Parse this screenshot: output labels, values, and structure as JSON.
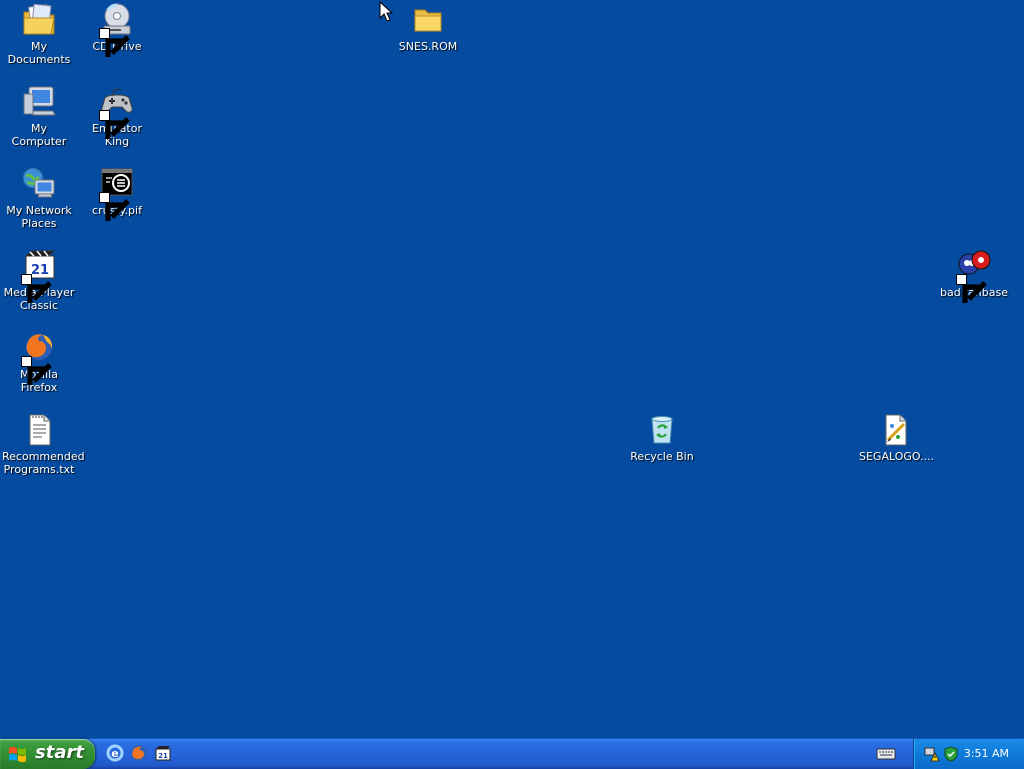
{
  "desktop": {
    "icons": [
      {
        "label": "My Documents",
        "icon": "my-documents-icon"
      },
      {
        "label": "CD Drive",
        "icon": "cd-drive-icon"
      },
      {
        "label": "SNES.ROM",
        "icon": "folder-icon"
      },
      {
        "label": "My Computer",
        "icon": "my-computer-icon"
      },
      {
        "label": "Emulator King",
        "icon": "gamepad-icon"
      },
      {
        "label": "My Network Places",
        "icon": "network-icon"
      },
      {
        "label": "crusty.pif",
        "icon": "msdos-program-icon"
      },
      {
        "label": "Media Player Classic",
        "icon": "media-player-icon"
      },
      {
        "label": "bad fanbase",
        "icon": "sonic-icon"
      },
      {
        "label": "Mozilla Firefox",
        "icon": "firefox-icon"
      },
      {
        "label": "Recommended Programs.txt",
        "icon": "text-file-icon"
      },
      {
        "label": "Recycle Bin",
        "icon": "recycle-bin-icon"
      },
      {
        "label": "SEGALOGO....",
        "icon": "paint-image-icon"
      }
    ]
  },
  "taskbar": {
    "start_label": "start",
    "quick_launch": [
      {
        "name": "internet-explorer-icon"
      },
      {
        "name": "firefox-icon"
      },
      {
        "name": "media-player-icon"
      }
    ],
    "clock": "3:51 AM"
  },
  "colors": {
    "desktop_bg": "#054ba0",
    "taskbar": "#2664d8",
    "start_green": "#3b9a3b",
    "tray": "#0f7ad9"
  }
}
